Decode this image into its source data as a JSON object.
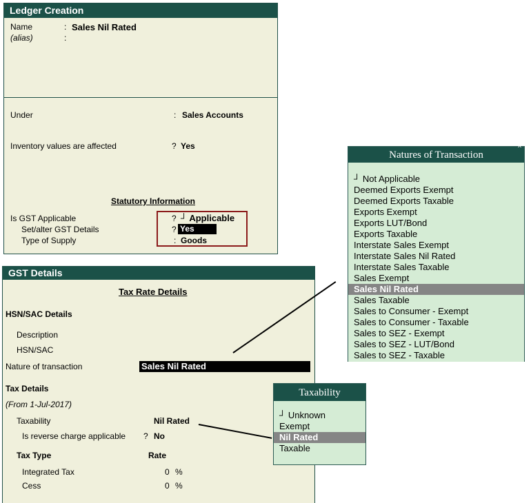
{
  "ledger": {
    "title": "Ledger Creation",
    "name_label": "Name",
    "alias_label": "(alias)",
    "colon": ":",
    "name_value": "Sales Nil Rated",
    "under_label": "Under",
    "under_value": "Sales Accounts",
    "inventory_label": "Inventory values are affected",
    "q": "?",
    "inventory_value": "Yes",
    "statutory_heading": "Statutory Information",
    "gst_applicable_label": "Is GST Applicable",
    "gst_applicable_value": "┘ Applicable",
    "set_alter_label": "Set/alter GST Details",
    "set_alter_value": "Yes",
    "supply_label": "Type of Supply",
    "supply_value": "Goods"
  },
  "gst": {
    "title": "GST Details",
    "tax_rate_heading": "Tax Rate Details",
    "hsn_heading": "HSN/SAC Details",
    "description_label": "Description",
    "hsn_label": "HSN/SAC",
    "nature_label": "Nature of transaction",
    "nature_value": "Sales Nil Rated",
    "tax_details_heading": "Tax Details",
    "from_date": "(From 1-Jul-2017)",
    "taxability_label": "Taxability",
    "taxability_value": "Nil Rated",
    "reverse_label": "Is reverse charge applicable",
    "reverse_value": "No",
    "tax_type_heading": "Tax Type",
    "rate_heading": "Rate",
    "integrated_label": "Integrated Tax",
    "integrated_value": "0",
    "cess_label": "Cess",
    "cess_value": "0",
    "percent": "%"
  },
  "natures": {
    "title": "Natures of Transaction",
    "close_glyph": "x",
    "items": [
      "┘ Not Applicable",
      "Deemed Exports Exempt",
      "Deemed Exports Taxable",
      "Exports Exempt",
      "Exports LUT/Bond",
      "Exports Taxable",
      "Interstate Sales Exempt",
      "Interstate Sales Nil Rated",
      "Interstate Sales Taxable",
      "Sales Exempt",
      "Sales Nil Rated",
      "Sales Taxable",
      "Sales to Consumer - Exempt",
      "Sales to Consumer - Taxable",
      "Sales to SEZ - Exempt",
      "Sales to SEZ - LUT/Bond",
      "Sales to SEZ - Taxable"
    ],
    "selected_index": 10
  },
  "taxability": {
    "title": "Taxability",
    "items": [
      "┘ Unknown",
      "Exempt",
      "Nil Rated",
      "Taxable"
    ],
    "selected_index": 2
  },
  "colors": {
    "header_bg": "#1b5148",
    "panel_bg": "#f0f0dc",
    "list_bg": "#d5ecd5",
    "selection_bg": "#858585",
    "highlight_box": "#8b1a1a"
  }
}
